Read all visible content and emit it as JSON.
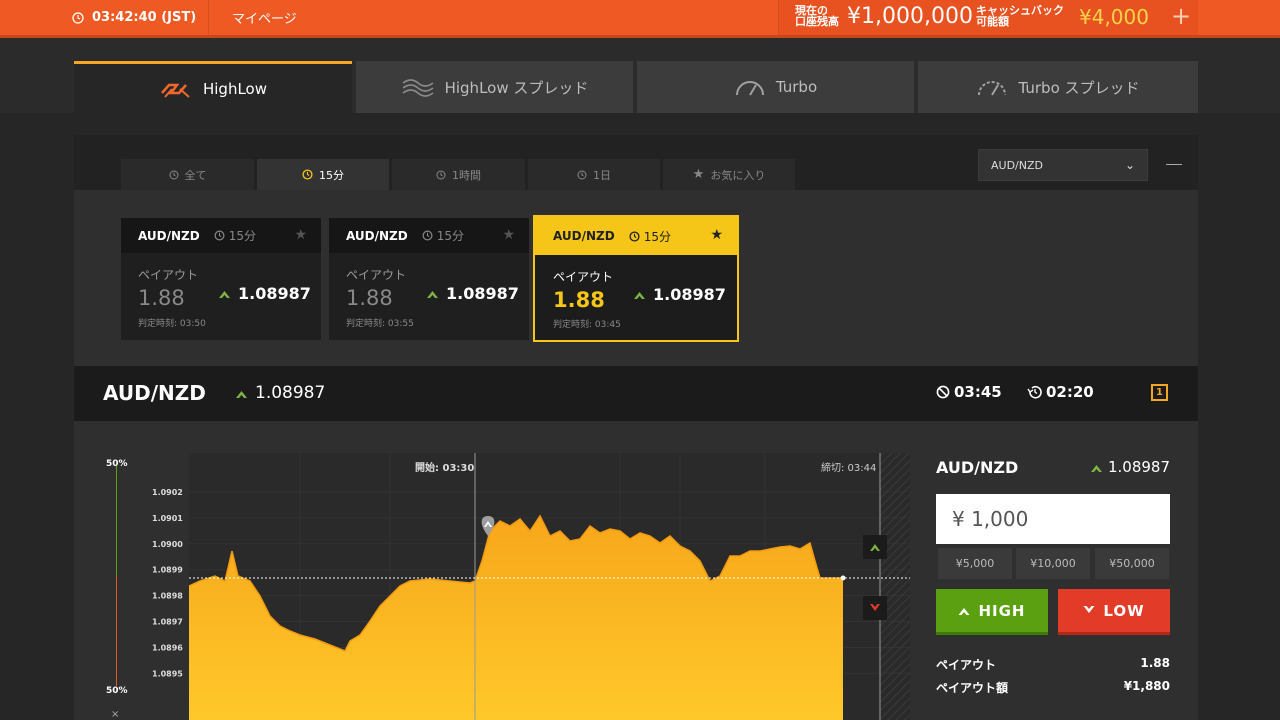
{
  "topbar": {
    "clock": "03:42:40 (JST)",
    "mypage": "マイページ",
    "balance_label": [
      "現在の",
      "口座残高"
    ],
    "balance": "¥1,000,000",
    "cashback_label": [
      "キャッシュバック",
      "可能額"
    ],
    "cashback": "¥4,000",
    "plus": "+"
  },
  "product_tabs": [
    {
      "label": "HighLow",
      "icon": "highlow-logo-icon",
      "active": true
    },
    {
      "label": "HighLow スプレッド",
      "icon": "spread-waves-icon",
      "active": false
    },
    {
      "label": "Turbo",
      "icon": "speedometer-icon",
      "active": false
    },
    {
      "label": "Turbo スプレッド",
      "icon": "speedometer-dashed-icon",
      "active": false
    }
  ],
  "filter_tabs": [
    {
      "label": "全て",
      "icon": "clock-icon",
      "active": false
    },
    {
      "label": "15分",
      "icon": "clock-icon",
      "active": true
    },
    {
      "label": "1時間",
      "icon": "clock-icon",
      "active": false
    },
    {
      "label": "1日",
      "icon": "clock-icon",
      "active": false
    },
    {
      "label": "お気に入り",
      "icon": "star-icon",
      "active": false
    }
  ],
  "asset_select": "AUD/NZD",
  "cards": [
    {
      "pair": "AUD/NZD",
      "duration": "15分",
      "payout_label": "ペイアウト",
      "payout": "1.88",
      "rate": "1.08987",
      "expiry": "判定時刻: 03:50",
      "active": false
    },
    {
      "pair": "AUD/NZD",
      "duration": "15分",
      "payout_label": "ペイアウト",
      "payout": "1.88",
      "rate": "1.08987",
      "expiry": "判定時刻: 03:55",
      "active": false
    },
    {
      "pair": "AUD/NZD",
      "duration": "15分",
      "payout_label": "ペイアウト",
      "payout": "1.88",
      "rate": "1.08987",
      "expiry": "判定時刻: 03:45",
      "active": true
    }
  ],
  "pair_bar": {
    "pair": "AUD/NZD",
    "rate": "1.08987",
    "expiry_time": "03:45",
    "remaining": "02:20",
    "badge": "1"
  },
  "chart": {
    "sentiment_top": "50%",
    "sentiment_bottom": "50%",
    "start_label": "開始: 03:30",
    "close_label": "締切: 03:44",
    "ylabels": [
      "1.0902",
      "1.0901",
      "1.0900",
      "1.0899",
      "1.0898",
      "1.0897",
      "1.0896",
      "1.0895"
    ],
    "close_x": "×",
    "colors": {
      "area_top": "#f7a71b",
      "area_bottom": "#ffc82a",
      "sentiment_up": "#5aa010",
      "sentiment_down": "#e2562c"
    }
  },
  "trade": {
    "pair": "AUD/NZD",
    "rate": "1.08987",
    "amount": "¥ 1,000",
    "quick_amounts": [
      "¥5,000",
      "¥10,000",
      "¥50,000"
    ],
    "high_label": "HIGH",
    "low_label": "LOW",
    "payout_label": "ペイアウト",
    "payout": "1.88",
    "payout_amount_label": "ペイアウト額",
    "payout_amount": "¥1,880"
  }
}
